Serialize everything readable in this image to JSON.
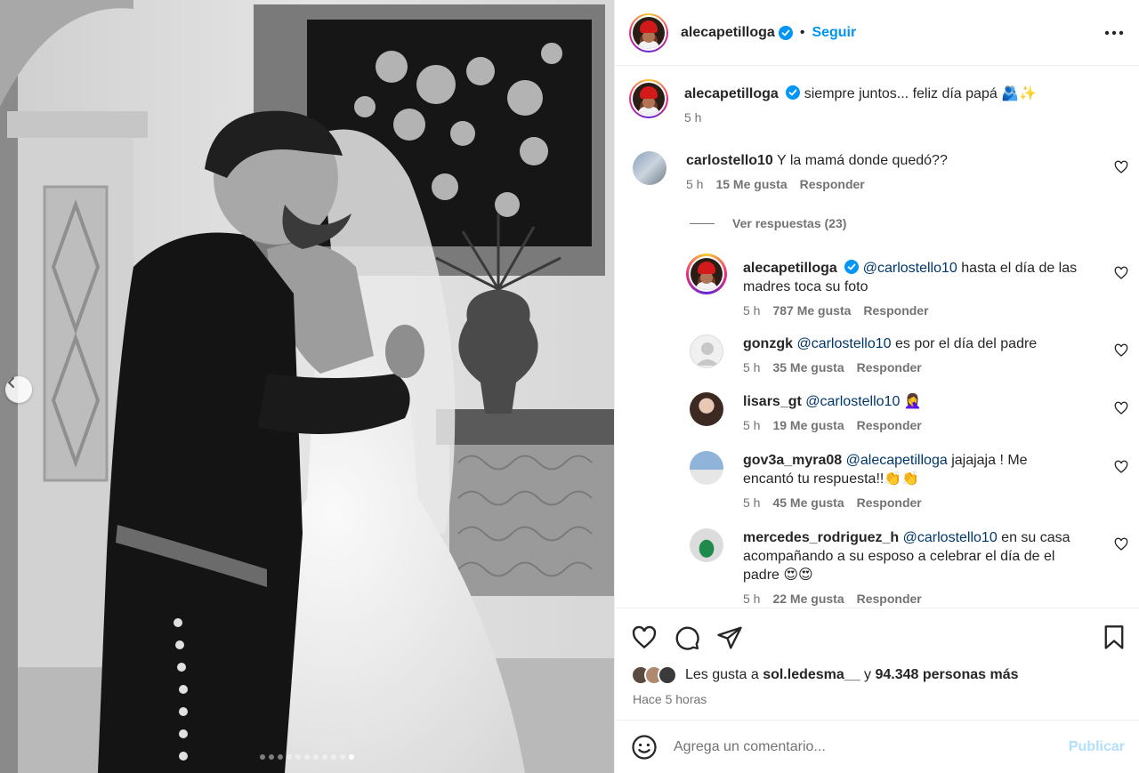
{
  "post": {
    "username": "alecapetilloga",
    "separator": "•",
    "follow_label": "Seguir",
    "caption": "siempre juntos... feliz día papá 🫂✨",
    "caption_time": "5 h"
  },
  "carousel": {
    "total": 11,
    "active_index": 10
  },
  "comments": [
    {
      "username": "carlostello10",
      "text": "Y la mamá donde quedó??",
      "time": "5 h",
      "likes": "15 Me gusta",
      "reply": "Responder"
    }
  ],
  "view_replies": "Ver respuestas (23)",
  "replies": [
    {
      "username": "alecapetilloga",
      "mention": "@carlostello10",
      "text_line1": "hasta el día de las",
      "text_line2": "madres toca su foto",
      "time": "5 h",
      "likes": "787 Me gusta",
      "reply": "Responder"
    },
    {
      "username": "gonzgk",
      "mention": "@carlostello10",
      "text_line1": "es por el día del padre",
      "time": "5 h",
      "likes": "35 Me gusta",
      "reply": "Responder"
    },
    {
      "username": "lisars_gt",
      "mention": "@carlostello10",
      "text_line1": "🤦‍♀️",
      "time": "5 h",
      "likes": "19 Me gusta",
      "reply": "Responder"
    },
    {
      "username": "gov3a_myra08",
      "mention": "@alecapetilloga",
      "text_line1": "jajajaja ! Me",
      "text_line2": "encantó tu respuesta!!👏👏",
      "time": "5 h",
      "likes": "45 Me gusta",
      "reply": "Responder"
    },
    {
      "username": "mercedes_rodriguez_h",
      "mention": "@carlostello10",
      "text_line1": "en su casa",
      "text_line2": "acompañando a su esposo a celebrar el día de el",
      "text_line3": "padre 😍😍",
      "time": "5 h",
      "likes": "22 Me gusta",
      "reply": "Responder"
    }
  ],
  "likes": {
    "prefix": "Les gusta a",
    "user": "sol.ledesma__",
    "conj": "y",
    "others": "94.348 personas más"
  },
  "posted_time": "Hace 5 horas",
  "comment_box": {
    "placeholder": "Agrega un comentario...",
    "publish_label": "Publicar"
  },
  "colors": {
    "link": "#0095f6",
    "mention": "#00376b",
    "muted": "#737373"
  }
}
